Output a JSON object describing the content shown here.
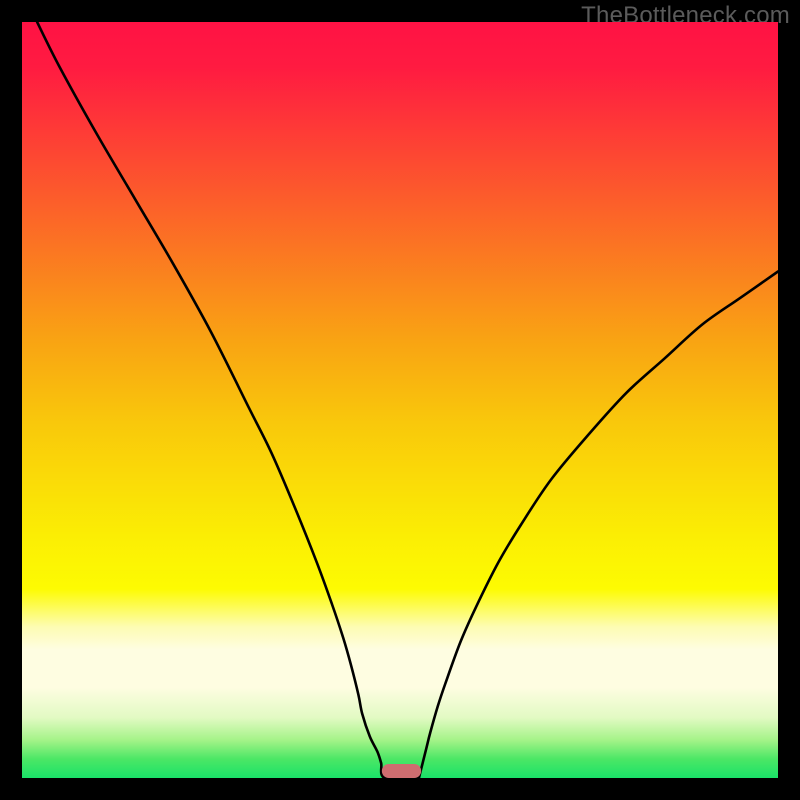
{
  "watermark": "TheBottleneck.com",
  "chart_data": {
    "type": "line",
    "title": "",
    "xlabel": "",
    "ylabel": "",
    "xlim": [
      0,
      100
    ],
    "ylim": [
      0,
      100
    ],
    "background": {
      "gradient_stops": [
        {
          "offset": 0.0,
          "color": "#ff1244"
        },
        {
          "offset": 0.06,
          "color": "#ff1b41"
        },
        {
          "offset": 0.24,
          "color": "#fc5f2a"
        },
        {
          "offset": 0.42,
          "color": "#f9a313"
        },
        {
          "offset": 0.53,
          "color": "#f9c80b"
        },
        {
          "offset": 0.68,
          "color": "#fbee04"
        },
        {
          "offset": 0.75,
          "color": "#fdfb02"
        },
        {
          "offset": 0.8,
          "color": "#fdfcb2"
        },
        {
          "offset": 0.83,
          "color": "#fefde1"
        },
        {
          "offset": 0.88,
          "color": "#fefde1"
        },
        {
          "offset": 0.92,
          "color": "#e2fac3"
        },
        {
          "offset": 0.95,
          "color": "#a4f388"
        },
        {
          "offset": 0.975,
          "color": "#4be765"
        },
        {
          "offset": 1.0,
          "color": "#1ae269"
        }
      ]
    },
    "series": [
      {
        "name": "curve",
        "color": "#000000",
        "x": [
          2,
          5,
          10,
          15,
          20,
          25,
          30,
          33,
          36,
          39,
          41,
          42.5,
          43.5,
          44.5,
          45,
          46,
          47,
          47.5,
          48,
          52.5,
          53,
          53.5,
          54,
          55,
          56,
          58,
          60,
          63,
          66,
          70,
          75,
          80,
          85,
          90,
          95,
          100
        ],
        "y": [
          100,
          94,
          85,
          76.5,
          68,
          59,
          49,
          43,
          36,
          28.5,
          23,
          18.5,
          15,
          11,
          8.5,
          5.5,
          3.5,
          2,
          0,
          0,
          2,
          4,
          6,
          9.5,
          12.5,
          18,
          22.5,
          28.5,
          33.5,
          39.5,
          45.5,
          51,
          55.5,
          60,
          63.5,
          67
        ]
      }
    ],
    "marker": {
      "x": 50.2,
      "width": 5.2,
      "color": "#ce6d70"
    }
  }
}
